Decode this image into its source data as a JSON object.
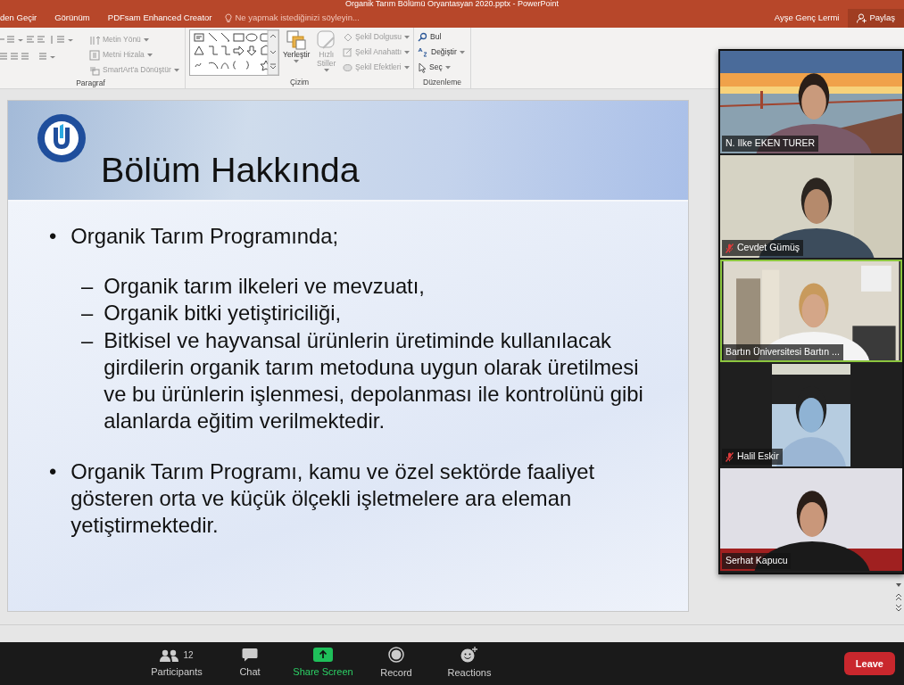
{
  "window": {
    "title": "Organik Tarım Bölümü Oryantasyan 2020.pptx - PowerPoint"
  },
  "ribbon_tabs": [
    "den Geçir",
    "Görünüm",
    "PDFsam Enhanced Creator"
  ],
  "tell_me": {
    "placeholder": "Ne yapmak istediğinizi söyleyin..."
  },
  "user": "Ayşe Genç Lermi",
  "share_button": "Paylaş",
  "ribbon_groups": [
    {
      "kind": "paragraph",
      "label": "Paragraf",
      "commands": [
        {
          "label": "Metin Yönü",
          "disabled": true
        },
        {
          "label": "Metni Hizala",
          "disabled": true
        },
        {
          "label": "SmartArt'a Dönüştür",
          "disabled": true
        }
      ]
    },
    {
      "kind": "drawing",
      "label": "Çizim",
      "commands": [
        {
          "label": "Yerleştir",
          "disabled": false
        },
        {
          "label": "Hızlı Stiller",
          "disabled": true
        },
        {
          "label": "Şekil Dolgusu",
          "disabled": true
        },
        {
          "label": "Şekil Anahattı",
          "disabled": true
        },
        {
          "label": "Şekil Efektleri",
          "disabled": true
        }
      ]
    },
    {
      "kind": "editing",
      "label": "Düzenleme",
      "commands": [
        {
          "label": "Bul",
          "disabled": false
        },
        {
          "label": "Değiştir",
          "disabled": false
        },
        {
          "label": "Seç",
          "disabled": false
        }
      ]
    }
  ],
  "slide": {
    "title": "Bölüm Hakkında",
    "bullets": [
      {
        "marker": "•",
        "text": "Organik Tarım Programında;",
        "children": [
          {
            "marker": "–",
            "text": "Organik tarım ilkeleri ve mevzuatı,"
          },
          {
            "marker": "–",
            "text": "Organik bitki yetiştiriciliği,"
          },
          {
            "marker": "–",
            "text": "Bitkisel ve hayvansal ürünlerin üretiminde kullanılacak girdilerin organik tarım metoduna uygun olarak üretilmesi ve bu ürünlerin işlenmesi, depolanması ile kontrolünü gibi alanlarda eğitim verilmektedir."
          }
        ]
      },
      {
        "marker": "•",
        "text": "Organik Tarım Programı, kamu ve özel sektörde faaliyet gösteren orta ve küçük ölçekli işletmelere ara eleman yetiştirmektedir."
      }
    ]
  },
  "participants": [
    {
      "name": "N. Ilke EKEN TURER",
      "muted": false,
      "active_speaker": false
    },
    {
      "name": "Cevdet Gümüş",
      "muted": true,
      "active_speaker": false
    },
    {
      "name": "Bartın Üniversitesi Bartın ...",
      "muted": false,
      "active_speaker": true
    },
    {
      "name": "Halil Eskir",
      "muted": true,
      "active_speaker": false
    },
    {
      "name": "Serhat Kapucu",
      "muted": false,
      "active_speaker": false
    }
  ],
  "toolbar": {
    "buttons": [
      {
        "kind": "participants",
        "label": "Participants",
        "count": "12"
      },
      {
        "kind": "chat",
        "label": "Chat"
      },
      {
        "kind": "share",
        "label": "Share Screen"
      },
      {
        "kind": "record",
        "label": "Record"
      },
      {
        "kind": "reactions",
        "label": "Reactions"
      }
    ],
    "leave_button": "Leave"
  }
}
